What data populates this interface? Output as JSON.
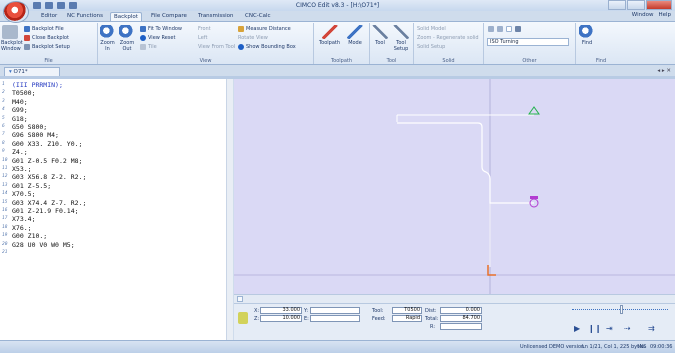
{
  "window": {
    "title": "CIMCO Edit v8.3 - [H:\\O71*]"
  },
  "ribbon_tabs": [
    "Editor",
    "NC Functions",
    "Backplot",
    "File Compare",
    "Transmission",
    "CNC-Calc"
  ],
  "right_menu": {
    "window": "Window",
    "help": "Help"
  },
  "ribbon": {
    "file": {
      "label": "File",
      "backplot_window": "Backplot Window",
      "backplot_file": "Backplot File",
      "close_backplot": "Close Backplot",
      "backplot_setup": "Backplot Setup"
    },
    "view": {
      "label": "View",
      "zoom_in": "Zoom In",
      "zoom_out": "Zoom Out",
      "fit_to_window": "Fit To Window",
      "view_reset": "View Reset",
      "tile": "Tile",
      "front": "Front",
      "left": "Left",
      "view_from_tool": "View From Tool",
      "measure_distance": "Measure Distance",
      "rotate_view": "Rotate View",
      "show_bounding_box": "Show Bounding Box"
    },
    "toolpath": {
      "label": "Toolpath",
      "toolpath": "Toolpath",
      "mode": "Mode"
    },
    "tool": {
      "label": "Tool",
      "tool": "Tool",
      "tool_setup": "Tool Setup"
    },
    "solid": {
      "label": "Solid",
      "solid_model": "Solid Model",
      "zoom_regen": "Zoom - Regenerate solid",
      "solid_setup": "Solid Setup"
    },
    "other": {
      "label": "Other",
      "mode_value": "ISO Turning"
    },
    "find": {
      "label": "Find",
      "find": "Find"
    }
  },
  "document": {
    "tab_label": "O71*"
  },
  "editor": {
    "lines": [
      {
        "n": "1",
        "code": "(III PRRMIN);",
        "hl": true
      },
      {
        "n": "2",
        "code": "T0500;"
      },
      {
        "n": "3",
        "code": "M40;"
      },
      {
        "n": "4",
        "code": "G99;"
      },
      {
        "n": "5",
        "code": "G18;"
      },
      {
        "n": "6",
        "code": "G50 S800;"
      },
      {
        "n": "7",
        "code": "G96 S800 M4;"
      },
      {
        "n": "8",
        "code": "G00 X33. Z10. Y0.;"
      },
      {
        "n": "9",
        "code": "Z4.;"
      },
      {
        "n": "10",
        "code": "G01 Z-0.5 F0.2 M8;"
      },
      {
        "n": "11",
        "code": "X53.;"
      },
      {
        "n": "12",
        "code": "G03 X56.8 Z-2. R2.;"
      },
      {
        "n": "13",
        "code": "G01 Z-5.5;"
      },
      {
        "n": "14",
        "code": "X70.5;"
      },
      {
        "n": "15",
        "code": "G03 X74.4 Z-7. R2.;"
      },
      {
        "n": "16",
        "code": "G01 Z-21.9 F0.14;"
      },
      {
        "n": "17",
        "code": "X73.4;"
      },
      {
        "n": "18",
        "code": "X76.;"
      },
      {
        "n": "19",
        "code": "G00 Z10.;"
      },
      {
        "n": "20",
        "code": "G28 U0 V0 W0 M5;"
      },
      {
        "n": "21",
        "code": ""
      }
    ]
  },
  "readout": {
    "x_label": "X:",
    "x_value": "33.000",
    "y_label": "Y:",
    "z_label": "Z:",
    "z_value": "10.000",
    "z2_label": "E:",
    "tool_label": "Tool:",
    "tool_value": "T0500",
    "feed_label": "Feed:",
    "feed_value": "Rapid",
    "dist_label": "Dist:",
    "dist_value": "0.000",
    "total_label": "Total:",
    "total_value": "84.700",
    "r_label": "R:"
  },
  "status": {
    "demo": "Unlicensed DEMO version",
    "pos": "Ln 1/21, Col 1, 225 bytes",
    "ins": "INS",
    "time": "09:00:36"
  },
  "colors": {
    "canvas": "#dad9f5",
    "toolpath": "#ffffff",
    "accent": "#2b4f94",
    "start_marker": "#22b14c",
    "end_marker": "#b23bd1"
  }
}
